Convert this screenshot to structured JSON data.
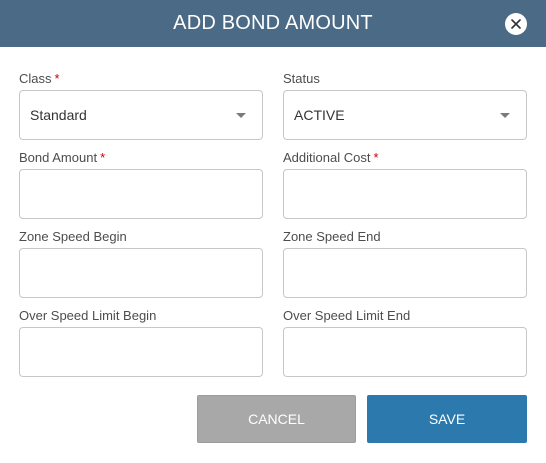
{
  "dialog": {
    "title": "ADD BOND AMOUNT",
    "header_color": "#4a6a86",
    "close_icon": "close-icon"
  },
  "form": {
    "class": {
      "label": "Class",
      "required": "*",
      "value": "Standard"
    },
    "status": {
      "label": "Status",
      "value": "ACTIVE"
    },
    "bond_amount": {
      "label": "Bond Amount",
      "required": "*",
      "value": ""
    },
    "additional_cost": {
      "label": "Additional Cost",
      "required": "*",
      "value": ""
    },
    "zone_speed_begin": {
      "label": "Zone Speed Begin",
      "value": ""
    },
    "zone_speed_end": {
      "label": "Zone Speed End",
      "value": ""
    },
    "over_speed_limit_begin": {
      "label": "Over Speed Limit Begin",
      "value": ""
    },
    "over_speed_limit_end": {
      "label": "Over Speed Limit End",
      "value": ""
    }
  },
  "actions": {
    "cancel_label": "CANCEL",
    "save_label": "SAVE",
    "save_color": "#2b79ad",
    "cancel_color": "#a8a8a8"
  }
}
